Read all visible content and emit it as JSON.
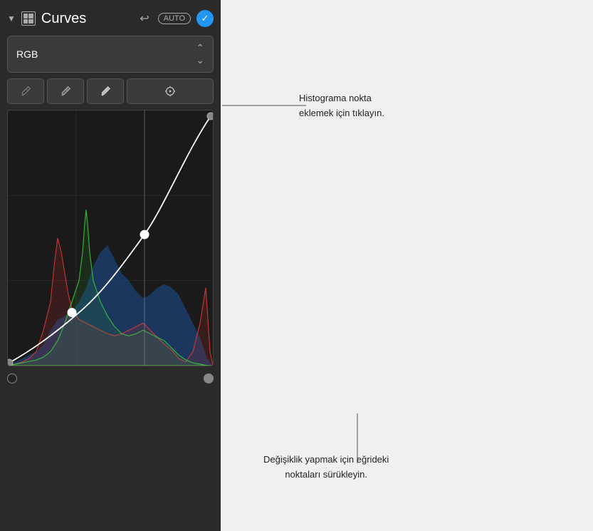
{
  "panel": {
    "title": "Curves",
    "collapse_icon": "▼",
    "undo_label": "↩",
    "auto_label": "AUTO",
    "check_label": "✓",
    "rgb_selector": {
      "label": "RGB",
      "chevron": "⌃⌄"
    },
    "tools": [
      {
        "id": "eyedropper-black",
        "icon": "eyedropper-black-icon"
      },
      {
        "id": "eyedropper-gray",
        "icon": "eyedropper-gray-icon"
      },
      {
        "id": "eyedropper-white",
        "icon": "eyedropper-white-icon"
      },
      {
        "id": "crosshair",
        "icon": "crosshair-icon"
      }
    ],
    "histogram": {
      "curve_points": [
        [
          0,
          360
        ],
        [
          90,
          280
        ],
        [
          180,
          200
        ],
        [
          240,
          130
        ],
        [
          285,
          10
        ]
      ]
    }
  },
  "annotations": {
    "top": {
      "text": "Histograma nokta\neklemek için tıklayın."
    },
    "bottom": {
      "text": "Değişiklik yapmak için eğrideki\nnoktaları sürükleyin."
    }
  }
}
